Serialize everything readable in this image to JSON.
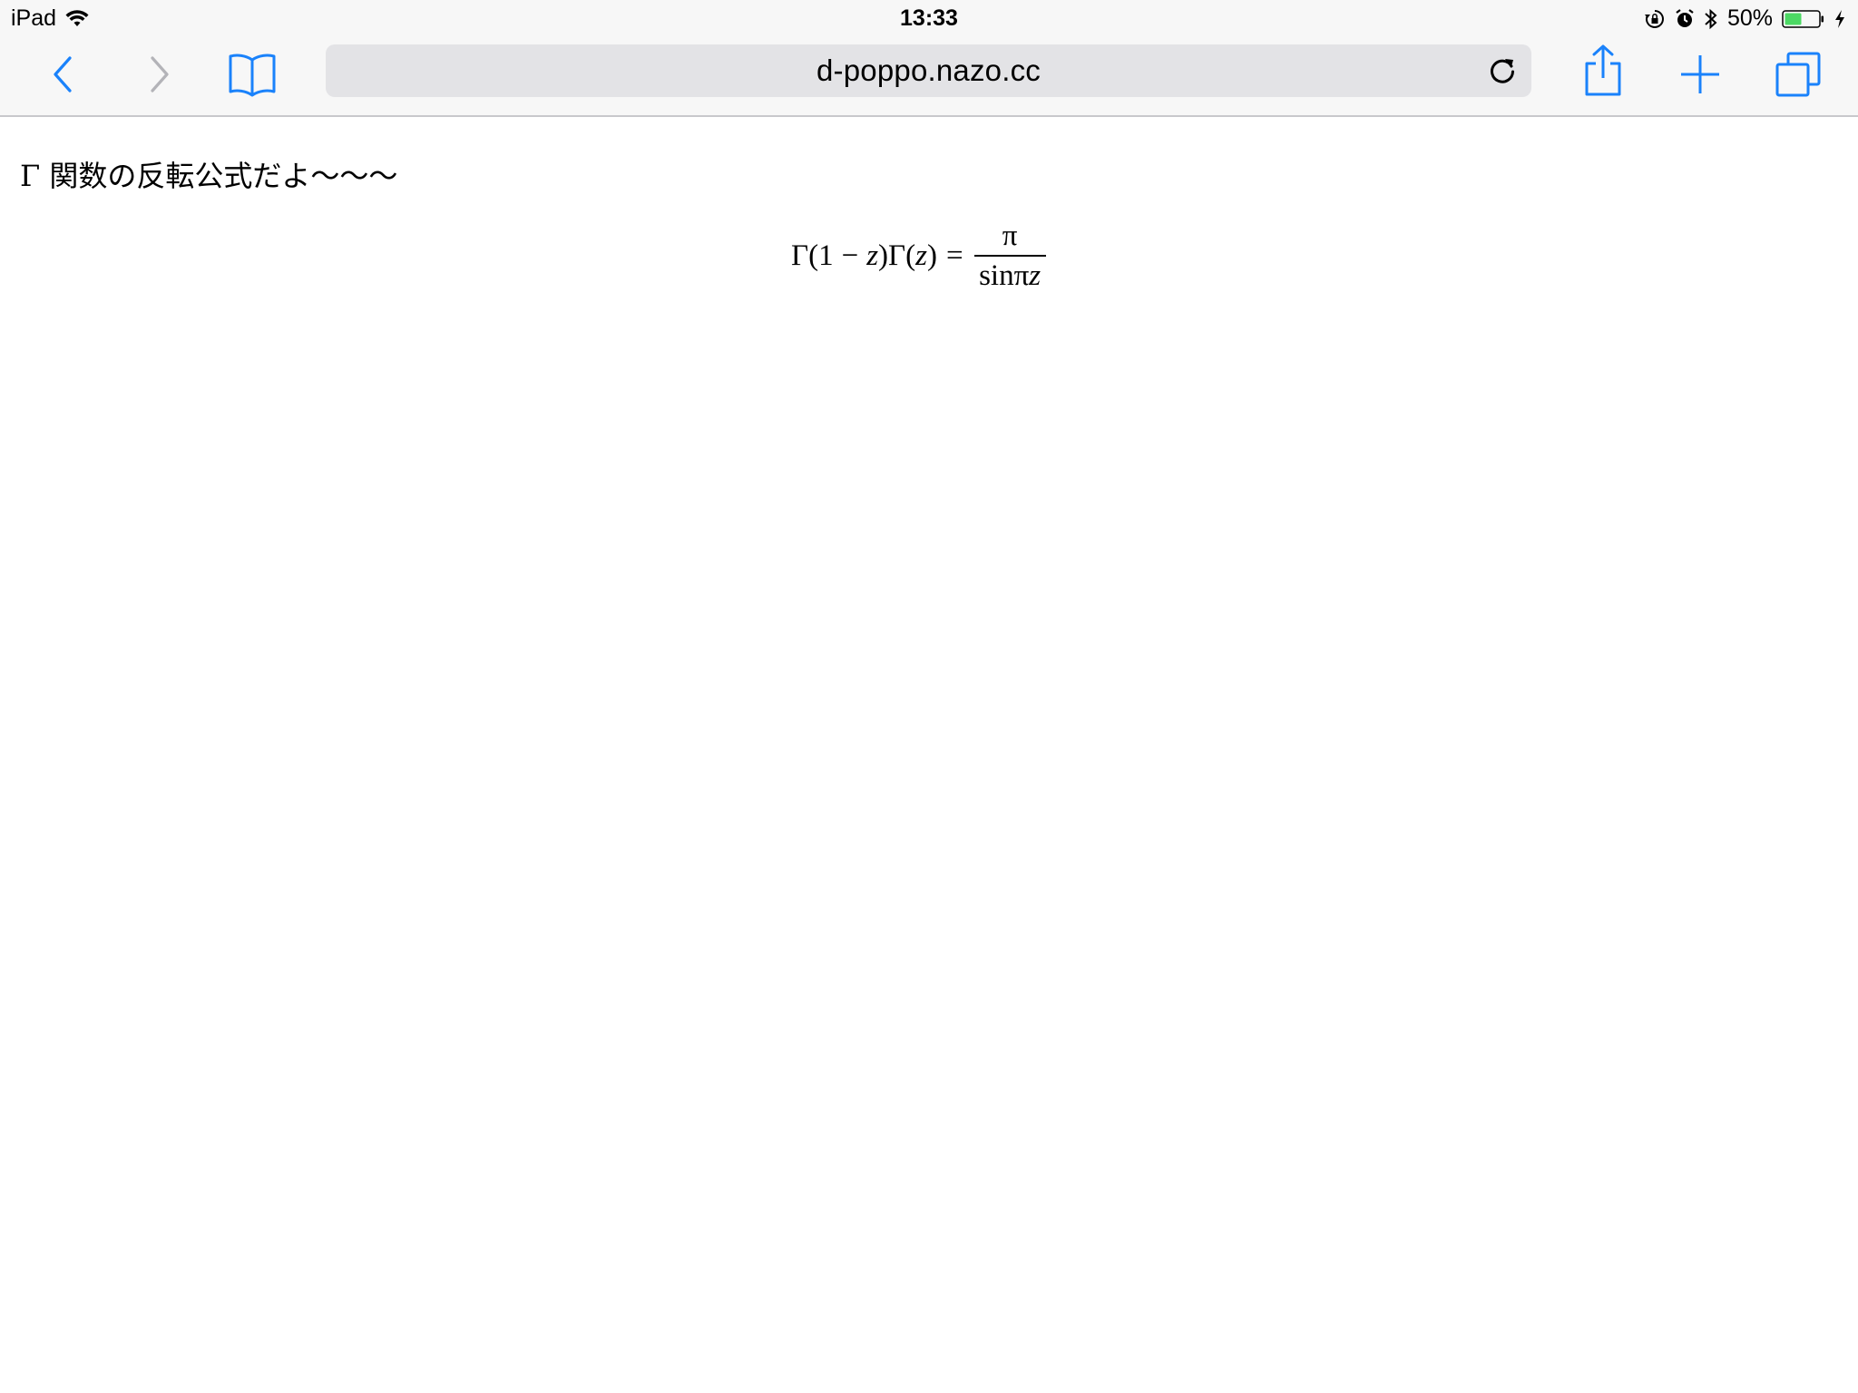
{
  "status_bar": {
    "device": "iPad",
    "time": "13:33",
    "battery_percent": "50%",
    "battery_level": 0.5,
    "icons": [
      "wifi-icon",
      "orientation-lock-icon",
      "alarm-icon",
      "bluetooth-icon",
      "battery-icon",
      "charging-icon"
    ]
  },
  "toolbar": {
    "url": "d-poppo.nazo.cc",
    "accent_color": "#1a82fb",
    "disabled_color": "#b3b3b8",
    "icons": [
      "back-icon",
      "forward-icon",
      "bookmarks-icon",
      "reload-icon",
      "share-icon",
      "new-tab-icon",
      "tabs-icon"
    ]
  },
  "page": {
    "intro": "Γ 関数の反転公式だよ〜〜〜",
    "formula": {
      "gamma1": "Γ",
      "open1": "(",
      "one": "1",
      "minus": "−",
      "z1": "z",
      "close1": ")",
      "gamma2": "Γ",
      "open2": "(",
      "z2": "z",
      "close2": ")",
      "equals": "=",
      "numerator": "π",
      "den_sin": "sin",
      "den_pi": "π",
      "den_z": "z"
    }
  }
}
